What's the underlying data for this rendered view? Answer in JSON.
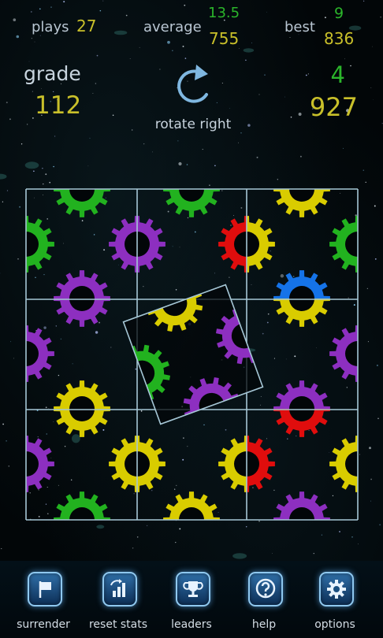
{
  "stats": {
    "plays_label": "plays",
    "plays_value": "27",
    "average_label": "average",
    "average_top": "13.5",
    "average_bottom": "755",
    "best_label": "best",
    "best_top": "9",
    "best_bottom": "836"
  },
  "grade": {
    "label": "grade",
    "value": "112"
  },
  "best_current": {
    "green_value": "4",
    "gold_value": "927"
  },
  "rotate": {
    "label": "rotate right",
    "icon": "rotate-right-icon"
  },
  "colors": {
    "green": "#22b21f",
    "purple": "#8d2fc0",
    "yellow": "#d9cc00",
    "red": "#e00d0d",
    "blue": "#1573e8",
    "grid": "#a6c7d6",
    "gold_text": "#c9c02a",
    "green_text": "#2bb52b"
  },
  "board": {
    "rows": 3,
    "cols": 3,
    "rotated_tile_angle_deg": -20
  },
  "app_bar": {
    "buttons": [
      {
        "label": "surrender",
        "icon": "flag-icon"
      },
      {
        "label": "reset stats",
        "icon": "reset-stats-icon"
      },
      {
        "label": "leaders",
        "icon": "trophy-icon"
      },
      {
        "label": "help",
        "icon": "help-icon"
      },
      {
        "label": "options",
        "icon": "gear-icon"
      }
    ]
  }
}
